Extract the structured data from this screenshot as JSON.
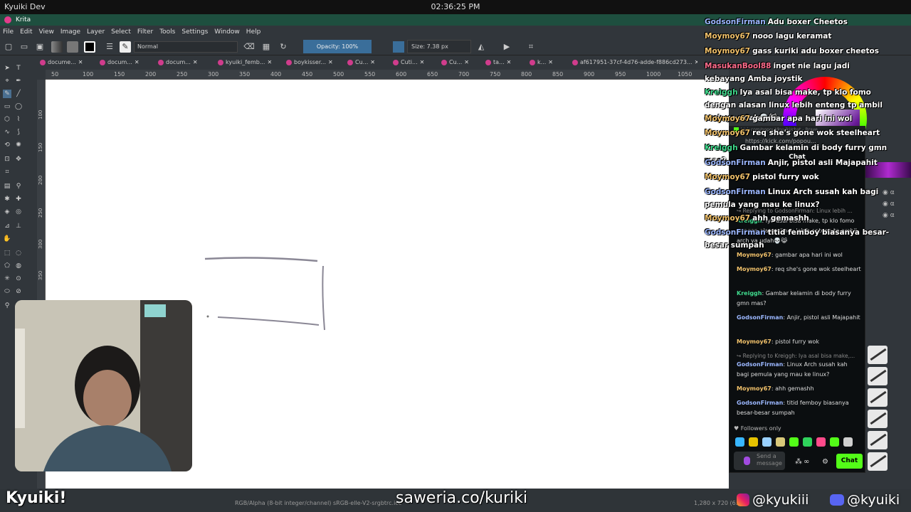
{
  "topbar": {
    "window_title": "Kyuiki Dev",
    "clock": "02:36:25 PM"
  },
  "app": {
    "title": "Krita"
  },
  "menu": [
    "File",
    "Edit",
    "View",
    "Image",
    "Layer",
    "Select",
    "Filter",
    "Tools",
    "Settings",
    "Window",
    "Help"
  ],
  "toolbar": {
    "blend_mode": "Normal",
    "opacity": "Opacity: 100%",
    "size": "Size: 7.38 px"
  },
  "tabs": [
    "docume...",
    "docum...",
    "docum...",
    "kyuiki_femb...",
    "boykisser...",
    "Cu...",
    "Cuti...",
    "Cu...",
    "ta...",
    "k...",
    "af617951-37cf-4d76-adde-f886cd273..."
  ],
  "ruler": {
    "top": [
      "50",
      "100",
      "150",
      "200",
      "250",
      "300",
      "350",
      "400",
      "450",
      "500",
      "550",
      "600",
      "650",
      "700",
      "750",
      "800",
      "850",
      "900",
      "950",
      "1000",
      "1050"
    ],
    "left": [
      "100",
      "150",
      "200",
      "250",
      "300",
      "350"
    ]
  },
  "status": {
    "colorspace": "RGB/Alpha (8-bit integer/channel)  sRGB-elle-V2-srgbtrc.icc",
    "dimensions": "1,280 x 720 (6..."
  },
  "overlay": {
    "name": "Kyuiki!",
    "saweria": "saweria.co/kuriki",
    "instagram": "@kyukiii",
    "discord": "@kyuiki"
  },
  "popup_chat": {
    "window_title": "kick.com/popout/kyuiki/chat - Brave",
    "url": "https://kick.com/popou...",
    "header": "Chat",
    "lines": [
      {
        "type": "reply",
        "text": "Replying to GodsonFirman: Linux lebih ..."
      },
      {
        "type": "msg",
        "user": "Kreiggh",
        "color": "#3fd98c",
        "text": "Iya asal bisa make, tp klo fomo dengan alasan linux lebih enteng tp ambil arch ya udah💀😹"
      },
      {
        "type": "msg",
        "user": "Moymoy67",
        "color": "#f2c26b",
        "text": "gambar apa hari ini wol"
      },
      {
        "type": "msg",
        "user": "Moymoy67",
        "color": "#f2c26b",
        "text": "req she's gone wok steelheart"
      },
      {
        "type": "msg",
        "user": "Kreiggh",
        "color": "#3fd98c",
        "text": "Gambar kelamin di body furry gmn mas?"
      },
      {
        "type": "msg",
        "user": "GodsonFirman",
        "color": "#9bb7ff",
        "text": "Anjir, pistol asli Majapahit"
      },
      {
        "type": "msg",
        "user": "Moymoy67",
        "color": "#f2c26b",
        "text": "pistol furry wok"
      },
      {
        "type": "reply",
        "text": "Replying to Kreiggh: Iya asal bisa make,..."
      },
      {
        "type": "msg",
        "user": "GodsonFirman",
        "color": "#9bb7ff",
        "text": "Linux Arch susah kah bagi pemula yang mau ke linux?"
      },
      {
        "type": "msg",
        "user": "Moymoy67",
        "color": "#f2c26b",
        "text": "ahh gemashh"
      },
      {
        "type": "msg",
        "user": "GodsonFirman",
        "color": "#9bb7ff",
        "text": "titid femboy biasanya besar-besar sumpah"
      }
    ],
    "followers_only": "Followers only",
    "send_placeholder": "Send a message",
    "chat_button": "Chat"
  },
  "stream_chat": [
    {
      "user": "GodsonFirman",
      "color": "#9bb7ff",
      "text": "Adu boxer Cheetos"
    },
    {
      "user": "Moymoy67",
      "color": "#f2c26b",
      "text": "nooo lagu keramat"
    },
    {
      "user": "Moymoy67",
      "color": "#f2c26b",
      "text": "gass kuriki adu boxer cheetos"
    },
    {
      "user": "MasukanBool88",
      "color": "#ff6b8b",
      "text": "inget nie lagu jadi kebayang Amba joystik"
    },
    {
      "user": "Kreiggh",
      "color": "#3fd98c",
      "text": "Iya asal bisa make, tp klo fomo dengan alasan linux lebih enteng tp ambil arch ya udah💀😹"
    },
    {
      "user": "Moymoy67",
      "color": "#f2c26b",
      "text": "gambar apa hari ini wol"
    },
    {
      "user": "Moymoy67",
      "color": "#f2c26b",
      "text": "req she's gone wok steelheart"
    },
    {
      "user": "Kreiggh",
      "color": "#3fd98c",
      "text": "Gambar kelamin di body furry gmn mas?"
    },
    {
      "user": "GodsonFirman",
      "color": "#9bb7ff",
      "text": "Anjir, pistol asli Majapahit"
    },
    {
      "user": "Moymoy67",
      "color": "#f2c26b",
      "text": "pistol furry wok"
    },
    {
      "user": "GodsonFirman",
      "color": "#9bb7ff",
      "text": "Linux Arch susah kah bagi pemula yang mau ke linux?"
    },
    {
      "user": "Moymoy67",
      "color": "#f2c26b",
      "text": "ahh gemashh"
    },
    {
      "user": "GodsonFirman",
      "color": "#9bb7ff",
      "text": "titid femboy biasanya besar-besar sumpah"
    }
  ]
}
